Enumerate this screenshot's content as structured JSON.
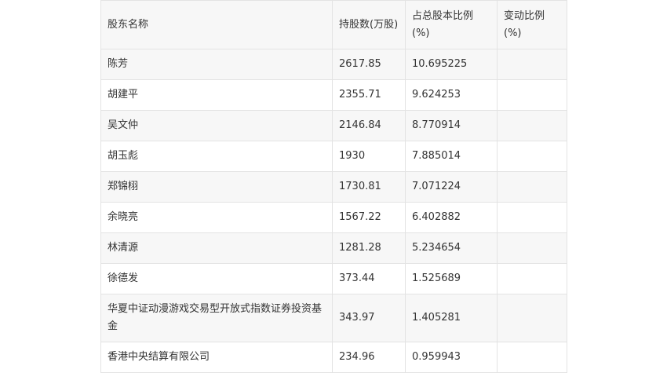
{
  "table": {
    "headers": [
      "股东名称",
      "持股数(万股)",
      "占总股本比例(%)",
      "变动比例(%)"
    ],
    "rows": [
      [
        "陈芳",
        "2617.85",
        "10.695225",
        ""
      ],
      [
        "胡建平",
        "2355.71",
        "9.624253",
        ""
      ],
      [
        "吴文仲",
        "2146.84",
        "8.770914",
        ""
      ],
      [
        "胡玉彪",
        "1930",
        "7.885014",
        ""
      ],
      [
        "郑锦栩",
        "1730.81",
        "7.071224",
        ""
      ],
      [
        "余晓亮",
        "1567.22",
        "6.402882",
        ""
      ],
      [
        "林清源",
        "1281.28",
        "5.234654",
        ""
      ],
      [
        "徐德发",
        "373.44",
        "1.525689",
        ""
      ],
      [
        "华夏中证动漫游戏交易型开放式指数证券投资基金",
        "343.97",
        "1.405281",
        ""
      ],
      [
        "香港中央结算有限公司",
        "234.96",
        "0.959943",
        ""
      ]
    ]
  }
}
